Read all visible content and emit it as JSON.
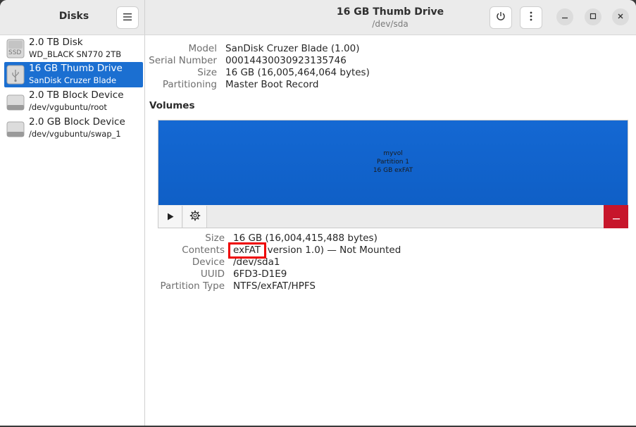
{
  "sidebar": {
    "title": "Disks",
    "menu_icon": "hamburger-menu-icon",
    "items": [
      {
        "name": "2.0 TB Disk",
        "sub": "WD_BLACK SN770 2TB",
        "icon": "ssd-icon",
        "icon_label": "SSD"
      },
      {
        "name": "16 GB Thumb Drive",
        "sub": "SanDisk Cruzer Blade",
        "icon": "usb-drive-icon"
      },
      {
        "name": "2.0 TB Block Device",
        "sub": "/dev/vgubuntu/root",
        "icon": "block-device-icon"
      },
      {
        "name": "2.0 GB Block Device",
        "sub": "/dev/vgubuntu/swap_1",
        "icon": "block-device-icon"
      }
    ]
  },
  "header": {
    "title": "16 GB Thumb Drive",
    "subtitle": "/dev/sda"
  },
  "drive": {
    "model_label": "Model",
    "model": "SanDisk Cruzer Blade (1.00)",
    "serial_label": "Serial Number",
    "serial": "00014430030923135746",
    "size_label": "Size",
    "size": "16 GB (16,005,464,064 bytes)",
    "partitioning_label": "Partitioning",
    "partitioning": "Master Boot Record"
  },
  "volumes": {
    "title": "Volumes",
    "bar": {
      "name": "myvol",
      "partition": "Partition 1",
      "summary": "16 GB exFAT"
    }
  },
  "partition": {
    "size_label": "Size",
    "size": "16 GB (16,004,415,488 bytes)",
    "contents_label": "Contents",
    "contents": "exFAT (version 1.0) — Not Mounted",
    "device_label": "Device",
    "device": "/dev/sda1",
    "uuid_label": "UUID",
    "uuid": "6FD3-D1E9",
    "type_label": "Partition Type",
    "type": "NTFS/exFAT/HPFS"
  },
  "colors": {
    "selection": "#1b6fd1",
    "volume_bar": "#1468d3",
    "delete": "#c7162b",
    "highlight": "#ee0000"
  }
}
